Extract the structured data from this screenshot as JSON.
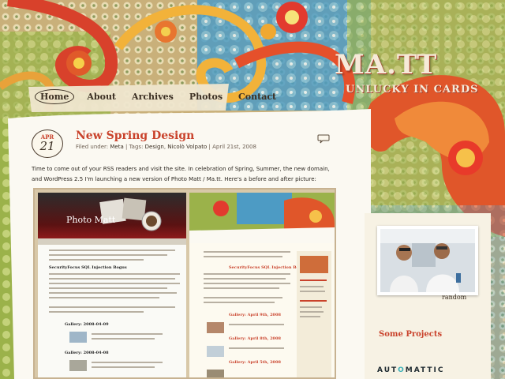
{
  "site": {
    "title": "MA.TT",
    "tagline": "UNLUCKY IN CARDS"
  },
  "nav": {
    "items": [
      {
        "label": "Home",
        "active": true
      },
      {
        "label": "About",
        "active": false
      },
      {
        "label": "Archives",
        "active": false
      },
      {
        "label": "Photos",
        "active": false
      },
      {
        "label": "Contact",
        "active": false
      }
    ]
  },
  "post": {
    "date_month": "APR",
    "date_day": "21",
    "title": "New Spring Design",
    "meta_prefix": "Filed under:",
    "category": "Meta",
    "tags_prefix": "| Tags:",
    "tag_1": "Design",
    "tag_2": "Nicolò Volpato",
    "date_text": "| April 21st, 2008",
    "body": "Time to come out of your RSS readers and visit the site. In celebration of Spring, Summer, the new domain, and WordPress 2.5 I'm launching a new version of Photo Matt / Ma.tt. Here's a before and after picture:"
  },
  "comparison": {
    "old_logo": "Photo Matt",
    "old_heading": "SecurityFocus SQL Injection Bogus",
    "old_galleries": [
      "Gallery: 2008-04-09",
      "Gallery: 2008-04-08"
    ],
    "new_heading": "SecurityFocus SQL Injection Bogus",
    "new_galleries": [
      "Gallery: April 9th, 2008",
      "Gallery: April 8th, 2008",
      "Gallery: April 5th, 2008"
    ]
  },
  "sidebar": {
    "random_label": "random",
    "projects_title": "Some Projects",
    "automattic_pre": "AUT",
    "automattic_o": "O",
    "automattic_post": "MATTIC"
  },
  "colors": {
    "accent": "#c9422b",
    "text": "#2c2720",
    "automattic_teal": "#3ab0b7"
  }
}
